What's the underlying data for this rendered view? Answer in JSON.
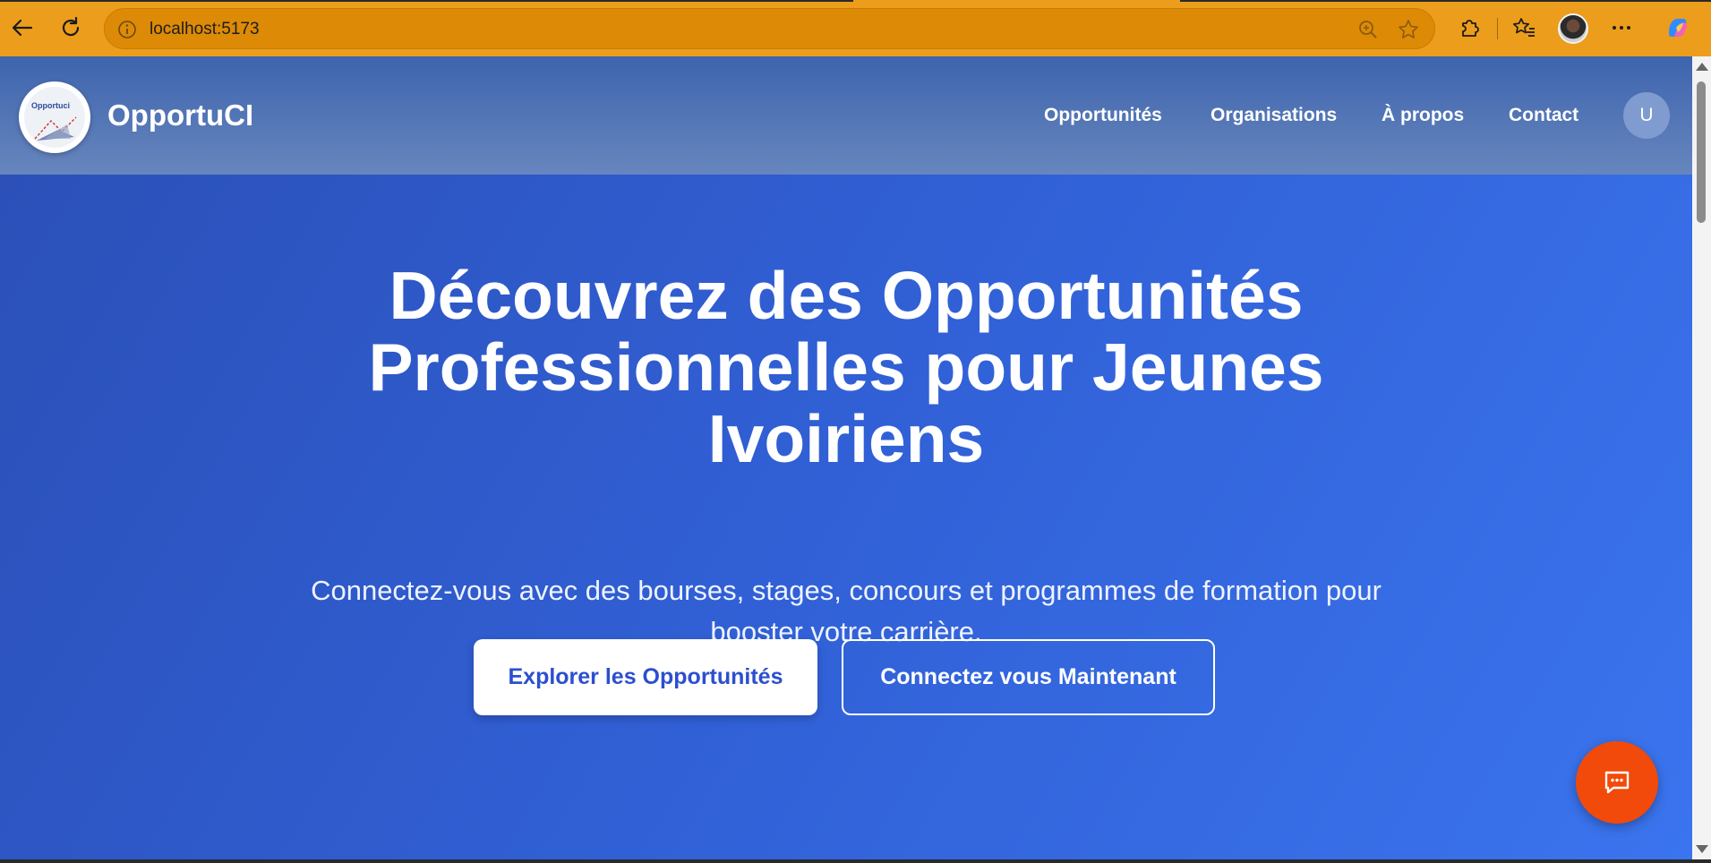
{
  "browser": {
    "url": "localhost:5173",
    "icons": [
      "back-icon",
      "reload-icon",
      "info-icon",
      "zoom-icon",
      "favorite-star-icon",
      "extensions-icon",
      "favorites-icon",
      "profile-avatar",
      "more-icon",
      "copilot-icon"
    ],
    "colors": {
      "toolbar": "#ec9d1b",
      "address_bar": "#dd8a06"
    }
  },
  "site": {
    "brand": "OpportuCI",
    "logo_text": "Opportuci",
    "nav": [
      "Opportunités",
      "Organisations",
      "À propos",
      "Contact"
    ],
    "user_initial": "U"
  },
  "hero": {
    "title_lines": [
      "Découvrez des Opportunités",
      "Professionnelles pour Jeunes",
      "Ivoiriens"
    ],
    "subtitle_lines": [
      "Connectez-vous avec des bourses, stages, concours et programmes de formation pour",
      "booster votre carrière."
    ],
    "primary_button": "Explorer les Opportunités",
    "secondary_button": "Connectez vous Maintenant"
  },
  "colors": {
    "hero_gradient_start": "#2b4fb6",
    "hero_gradient_end": "#3a74ee",
    "chat_button": "#f24a0a"
  }
}
